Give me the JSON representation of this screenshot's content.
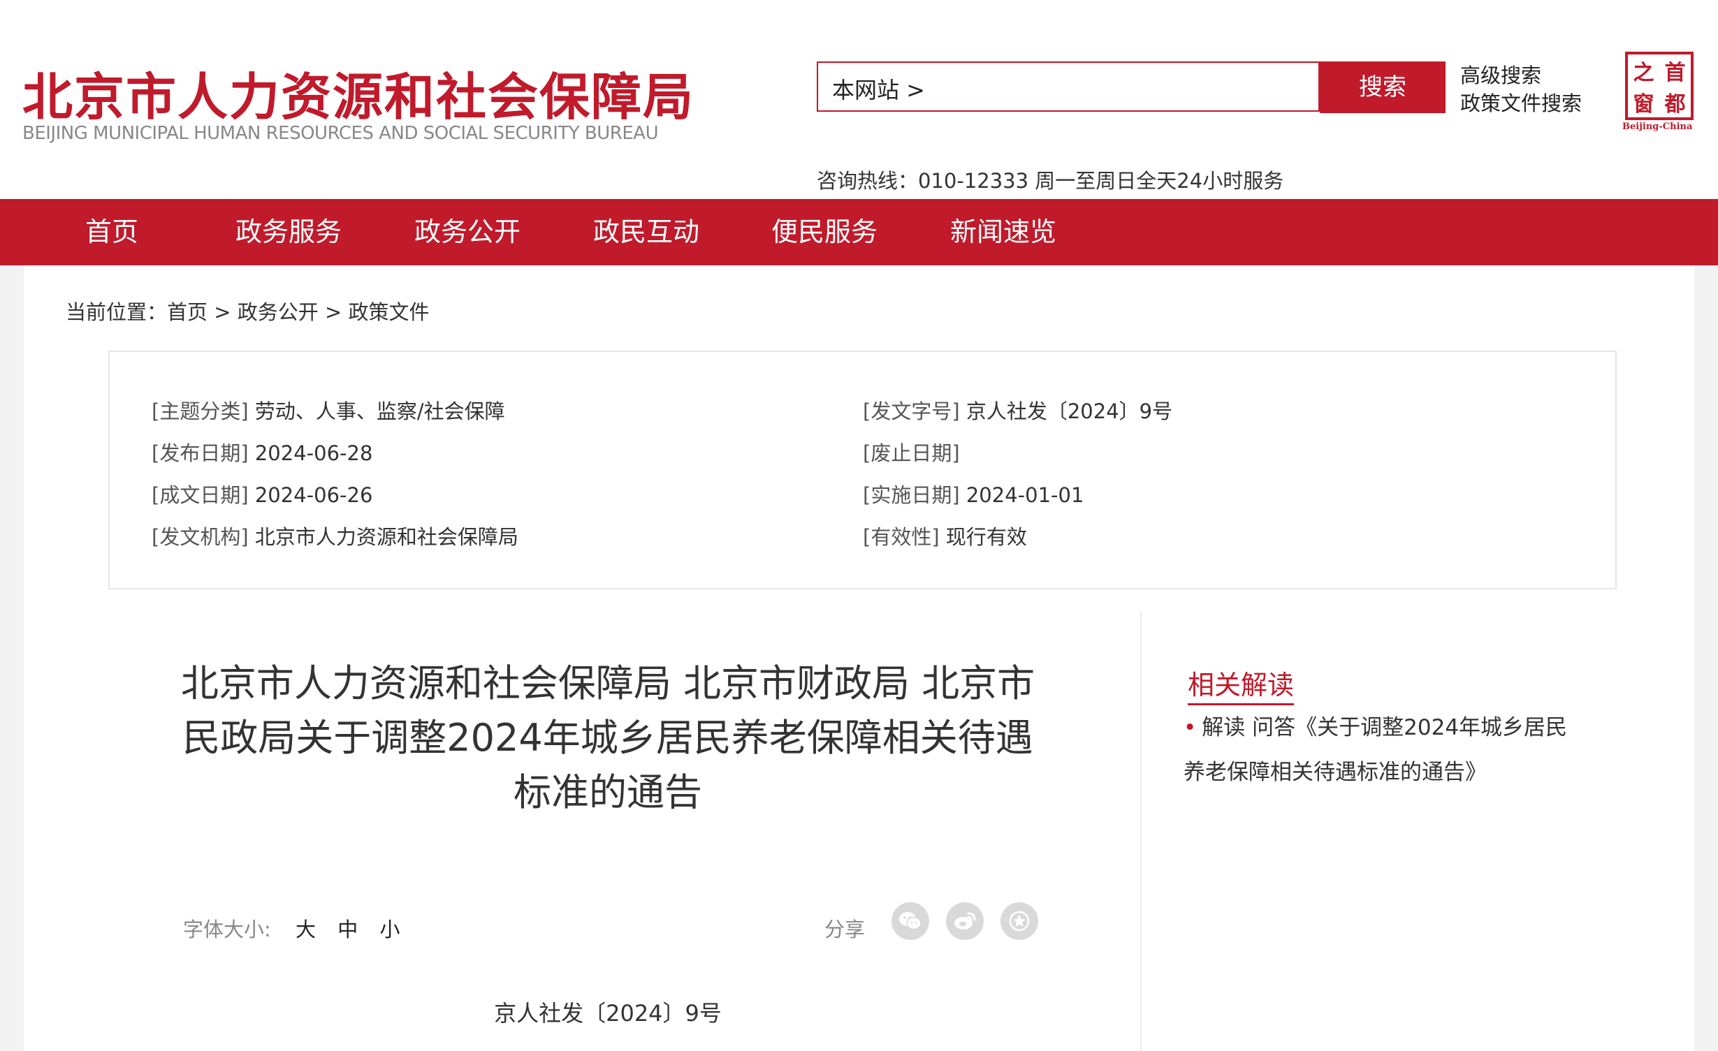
{
  "header": {
    "title": "北京市人力资源和社会保障局",
    "subtitle": "BEIJING MUNICIPAL HUMAN RESOURCES AND SOCIAL SECURITY BUREAU",
    "search_scope": "本网站 >",
    "search_button": "搜索",
    "advanced_search": "高级搜索",
    "policy_search": "政策文件搜索",
    "logo_chars": [
      "之",
      "首",
      "窗",
      "都"
    ],
    "logo_caption": "Beijing-China",
    "hotline": "咨询热线：010-12333 周一至周日全天24小时服务"
  },
  "nav": {
    "items": [
      "首页",
      "政务服务",
      "政务公开",
      "政民互动",
      "便民服务",
      "新闻速览"
    ]
  },
  "breadcrumb": {
    "prefix": "当前位置：",
    "items": [
      "首页",
      "政务公开",
      "政策文件"
    ],
    "separator": " > "
  },
  "meta": {
    "left": [
      {
        "key": "[主题分类]",
        "value": "劳动、人事、监察/社会保障"
      },
      {
        "key": "[发布日期]",
        "value": "2024-06-28"
      },
      {
        "key": "[成文日期]",
        "value": "2024-06-26"
      },
      {
        "key": "[发文机构]",
        "value": "北京市人力资源和社会保障局"
      }
    ],
    "right": [
      {
        "key": "[发文字号]",
        "value": "京人社发〔2024〕9号"
      },
      {
        "key": "[废止日期]",
        "value": ""
      },
      {
        "key": "[实施日期]",
        "value": "2024-01-01"
      },
      {
        "key": "[有效性]",
        "value": "现行有效"
      }
    ]
  },
  "document": {
    "title_lines": [
      "北京市人力资源和社会保障局 北京市财政局 北京市",
      "民政局关于调整2024年城乡居民养老保障相关待遇",
      "标准的通告"
    ],
    "font_size_label": "字体大小:",
    "font_size_options": [
      "大",
      "中",
      "小"
    ],
    "share_label": "分享",
    "share_icons": [
      "wechat-icon",
      "weibo-icon",
      "favorite-icon"
    ],
    "doc_number": "京人社发〔2024〕9号"
  },
  "related": {
    "title": "相关解读",
    "items": [
      {
        "text": "解读 问答《关于调整2024年城乡居民养老保障相关待遇标准的通告》"
      }
    ]
  },
  "colors": {
    "brand_red": "#c01a2b",
    "share_gray": "#d9d9d9"
  }
}
